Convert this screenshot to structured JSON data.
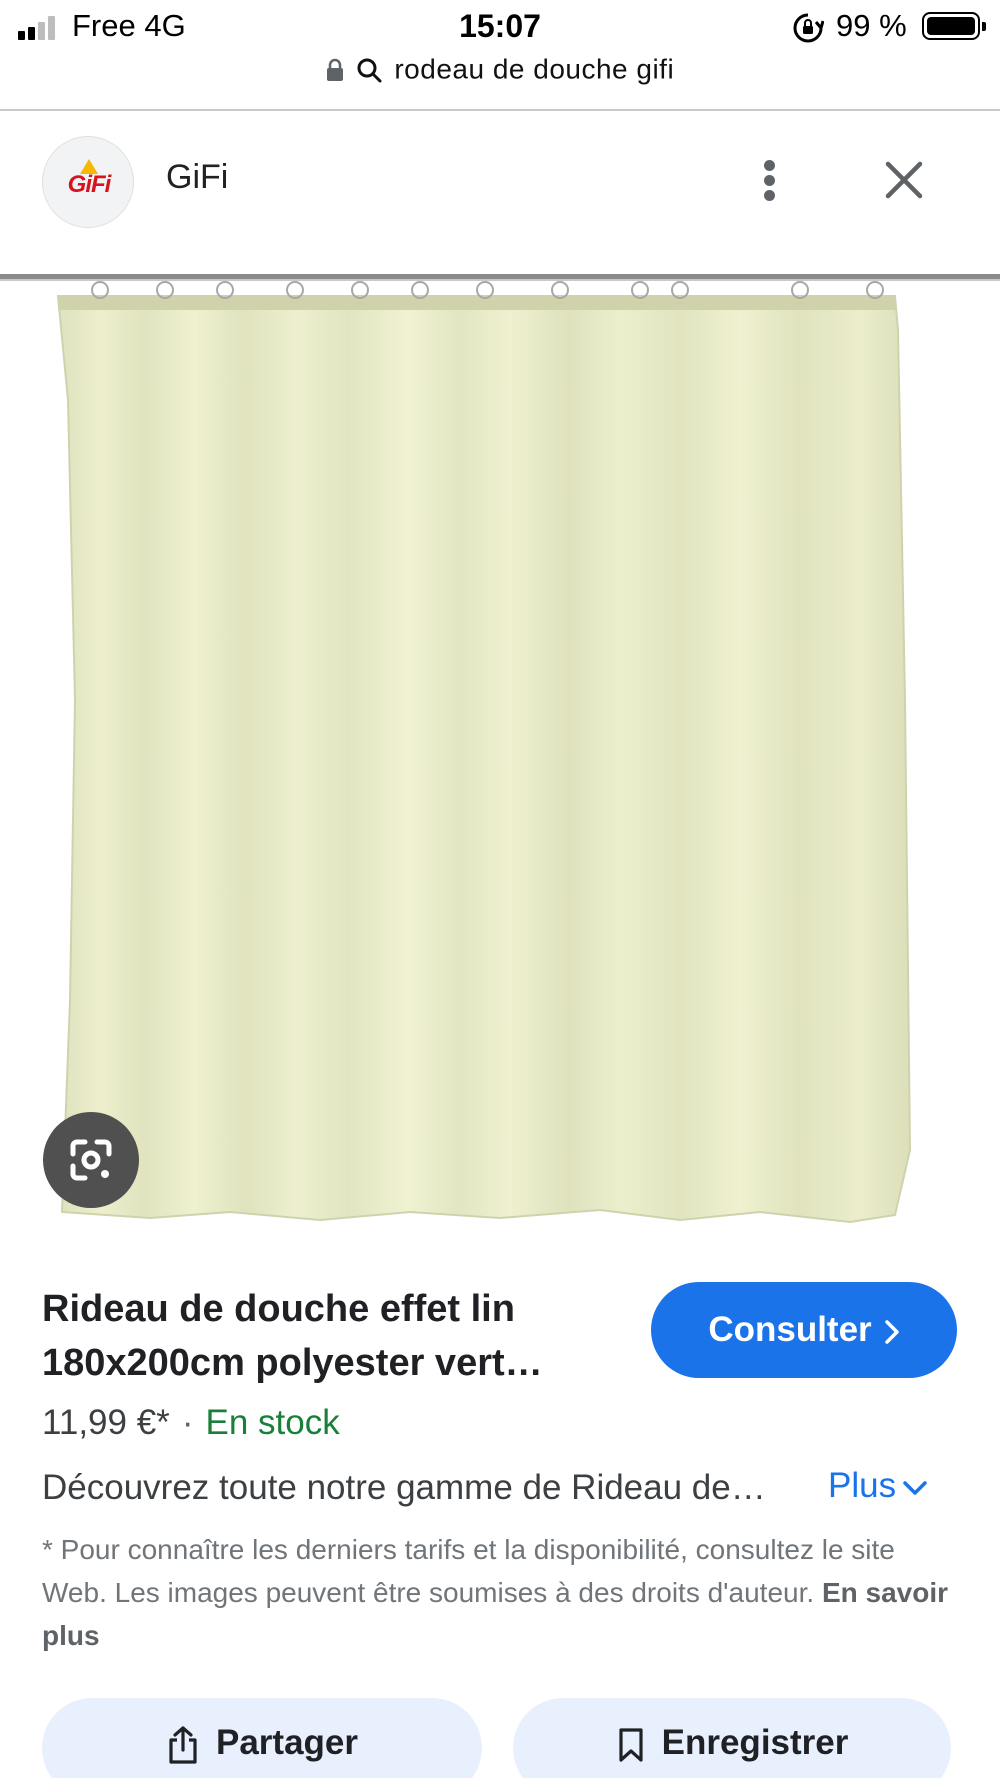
{
  "status_bar": {
    "carrier": "Free   4G",
    "time": "15:07",
    "battery_percent": "99 %"
  },
  "browser": {
    "url_text": "rodeau de douche gifi"
  },
  "source": {
    "logo_text": "GiFi",
    "name": "GiFi"
  },
  "product": {
    "title": "Rideau de douche effet lin 180x200cm polyester vert…",
    "price": "11,99 €*",
    "separator": "·",
    "stock": "En stock",
    "description": "Découvrez toute notre gamme de Rideau de…",
    "more_label": "Plus",
    "disclaimer": "* Pour connaître les derniers tarifs et la disponibilité, consultez le site Web. Les images peuvent être soumises à des droits d'auteur.",
    "learn_more": "En savoir plus"
  },
  "actions": {
    "consult_label": "Consulter",
    "share_label": "Partager",
    "save_label": "Enregistrer"
  },
  "colors": {
    "accent": "#1a73e8",
    "stock_green": "#188038",
    "curtain": "#e6e9c4",
    "action_bg": "#e8f0fe"
  },
  "icons": [
    "signal-icon",
    "rotation-lock-icon",
    "battery-icon",
    "lock-icon",
    "search-icon",
    "more-vert-icon",
    "close-icon",
    "lens-icon",
    "chevron-right-icon",
    "chevron-down-icon",
    "share-icon",
    "bookmark-icon"
  ]
}
